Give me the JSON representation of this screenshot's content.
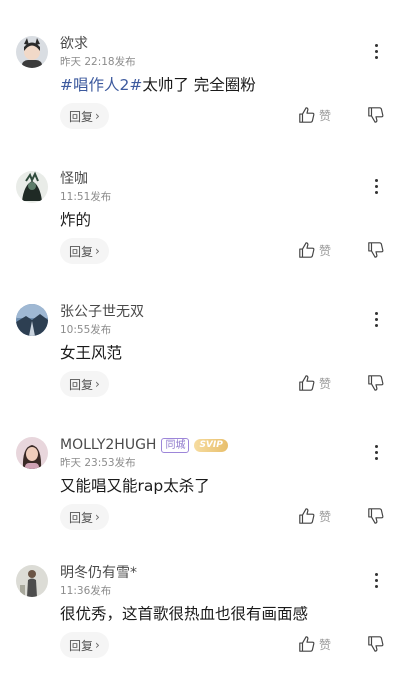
{
  "comments": [
    {
      "username": "欲求",
      "time": "昨天 22:18发布",
      "content_tag": "#唱作人2#",
      "content": "太帅了  完全圈粉",
      "reply_label": "回复",
      "like_label": "赞",
      "avatar_icon": "avatar-cat-ears-girl"
    },
    {
      "username": "怪咖",
      "time": "11:51发布",
      "content_tag": "",
      "content": "炸的",
      "reply_label": "回复",
      "like_label": "赞",
      "avatar_icon": "avatar-dark-figure"
    },
    {
      "username": "张公子世无双",
      "time": "10:55发布",
      "content_tag": "",
      "content": "女王风范",
      "reply_label": "回复",
      "like_label": "赞",
      "avatar_icon": "avatar-road-landscape"
    },
    {
      "username": "MOLLY2HUGH",
      "badge_tongcheng": "同城",
      "badge_svip": "SVIP",
      "time": "昨天 23:53发布",
      "content_tag": "",
      "content": "又能唱又能rap太杀了",
      "reply_label": "回复",
      "like_label": "赞",
      "avatar_icon": "avatar-girl-portrait"
    },
    {
      "username": "明冬仍有雪*",
      "time": "11:36发布",
      "content_tag": "",
      "content": "很优秀，这首歌很热血也很有画面感",
      "reply_label": "回复",
      "like_label": "赞",
      "avatar_icon": "avatar-man-standing"
    }
  ],
  "colors": {
    "hashtag": "#3d5a9e",
    "secondary_text": "#8c8c8c",
    "badge_tongcheng": "#8e78cc",
    "badge_svip": "#e8bf6c"
  }
}
